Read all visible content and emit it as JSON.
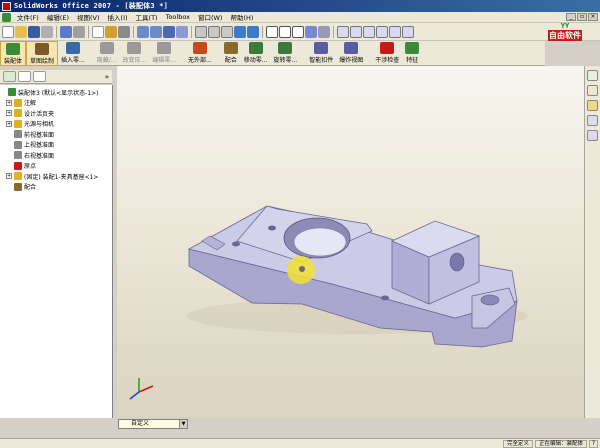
{
  "window": {
    "title": "SolidWorks Office 2007 - [装配体3 *]"
  },
  "menu": {
    "items": [
      "文件(F)",
      "编辑(E)",
      "视图(V)",
      "插入(I)",
      "工具(T)",
      "Toolbox",
      "窗口(W)",
      "帮助(H)"
    ]
  },
  "logo": {
    "top": "YY",
    "mark": "自由软件"
  },
  "command_manager": {
    "items": [
      {
        "label": "装配体",
        "active": true,
        "color": "#3a8a3a"
      },
      {
        "label": "草图绘制",
        "active": true,
        "color": "#7a5a2a"
      },
      {
        "label": "插入零...",
        "active": false,
        "color": "#3a6aa5"
      },
      {
        "label": "隐藏/...",
        "active": false,
        "color": "#999999"
      },
      {
        "label": "改变压...",
        "active": false,
        "color": "#999999"
      },
      {
        "label": "编辑零...",
        "active": false,
        "color": "#999999"
      },
      {
        "label": "无外部...",
        "active": false,
        "color": "#c84a1a"
      },
      {
        "label": "配合",
        "active": false,
        "color": "#8a6a2a"
      },
      {
        "label": "移动零...",
        "active": false,
        "color": "#3a7a3a"
      },
      {
        "label": "旋转零...",
        "active": false,
        "color": "#3a7a3a"
      },
      {
        "label": "智能扣件",
        "active": false,
        "color": "#5a5aa5"
      },
      {
        "label": "爆炸视图",
        "active": false,
        "color": "#5a5aa5"
      },
      {
        "label": "干涉检查",
        "active": false,
        "color": "#c81818"
      },
      {
        "label": "特征",
        "active": false,
        "color": "#3a8a3a"
      }
    ]
  },
  "feature_tree": {
    "nodes": [
      {
        "label": "装配体3  (默认<显示状态-1>)",
        "expander": false,
        "icon": "assembly-icon",
        "color": "#3a8a3a"
      },
      {
        "label": "注解",
        "expander": true,
        "icon": "annotation-icon",
        "color": "#e0b020"
      },
      {
        "label": "设计活页夹",
        "expander": true,
        "icon": "binder-icon",
        "color": "#e0b020"
      },
      {
        "label": "光源与相机",
        "expander": true,
        "icon": "light-icon",
        "color": "#e0b020"
      },
      {
        "label": "前视基准面",
        "expander": false,
        "icon": "plane-icon",
        "color": "#888888"
      },
      {
        "label": "上视基准面",
        "expander": false,
        "icon": "plane-icon",
        "color": "#888888"
      },
      {
        "label": "右视基准面",
        "expander": false,
        "icon": "plane-icon",
        "color": "#888888"
      },
      {
        "label": "原点",
        "expander": false,
        "icon": "origin-icon",
        "color": "#c81818"
      },
      {
        "label": "(固定) 装配1-夹具基座<1>",
        "expander": true,
        "icon": "part-icon",
        "color": "#e0b020"
      },
      {
        "label": "配合",
        "expander": false,
        "icon": "mates-icon",
        "color": "#8a6a2a"
      }
    ]
  },
  "config_dropdown": {
    "value": "自定义"
  },
  "status_bar": {
    "state": "完全定义",
    "editing": "正在编辑：装配体"
  },
  "colors": {
    "part": "#c9c9e6",
    "part_shade": "#a6a4cc",
    "highlight": "#f2e230"
  }
}
